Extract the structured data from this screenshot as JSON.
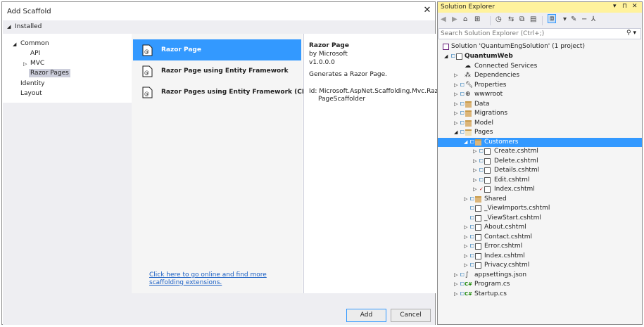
{
  "dialog": {
    "title": "Add Scaffold",
    "close_glyph": "✕",
    "installed_label": "Installed",
    "tree": {
      "common": "Common",
      "api": "API",
      "mvc": "MVC",
      "razor_pages": "Razor Pages",
      "identity": "Identity",
      "layout": "Layout"
    },
    "templates": [
      {
        "label": "Razor Page",
        "selected": true
      },
      {
        "label": "Razor Page using Entity Framework",
        "selected": false
      },
      {
        "label": "Razor Pages using Entity Framework (CRUD)",
        "selected": false
      }
    ],
    "online_link": "Click here to go online and find more scaffolding extensions.",
    "details": {
      "title": "Razor Page",
      "author": "by Microsoft",
      "version": "v1.0.0.0",
      "description": "Generates a Razor Page.",
      "id_line1": "Id: Microsoft.AspNet.Scaffolding.Mvc.Razor",
      "id_line2": "PageScaffolder"
    },
    "buttons": {
      "add": "Add",
      "cancel": "Cancel"
    }
  },
  "solution_explorer": {
    "title": "Solution Explorer",
    "controls": {
      "dropdown": "▾",
      "pin": "⊓",
      "close": "✕"
    },
    "search_placeholder": "Search Solution Explorer (Ctrl+;)",
    "search_icon": "search-icon",
    "tree": {
      "solution": "Solution 'QuantumEngSolution' (1 project)",
      "project": "QuantumWeb",
      "connected_services": "Connected Services",
      "dependencies": "Dependencies",
      "properties": "Properties",
      "wwwroot": "wwwroot",
      "data": "Data",
      "migrations": "Migrations",
      "model": "Model",
      "pages": "Pages",
      "customers": "Customers",
      "customers_files": [
        "Create.cshtml",
        "Delete.cshtml",
        "Details.cshtml",
        "Edit.cshtml",
        "Index.cshtml"
      ],
      "shared": "Shared",
      "pages_files": [
        "_ViewImports.cshtml",
        "_ViewStart.cshtml"
      ],
      "pages_cshtml": [
        "About.cshtml",
        "Contact.cshtml",
        "Error.cshtml",
        "Index.cshtml",
        "Privacy.cshtml"
      ],
      "appsettings": "appsettings.json",
      "program": "Program.cs",
      "startup": "Startup.cs"
    }
  },
  "colors": {
    "selection": "#3399ff",
    "titlebar_active": "#fff29d",
    "panel_bg": "#eeeef2"
  }
}
